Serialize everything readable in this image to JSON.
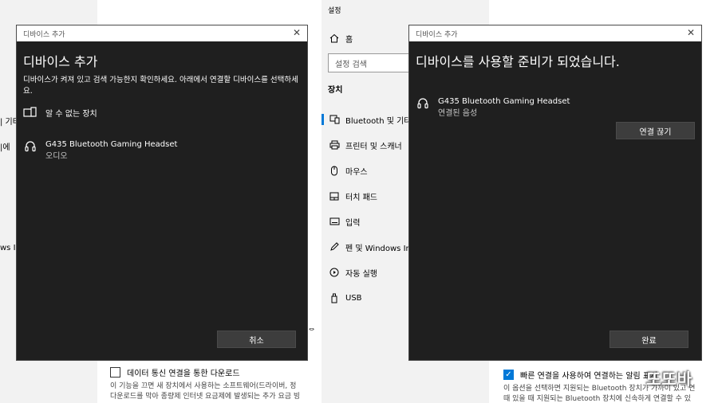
{
  "left_bg": {
    "fragment_1": "| 기타",
    "fragment_2": "|에",
    "fragment_3": "ws Ink",
    "fragment_4": "ᆼ",
    "checkbox_label": "데이터 통신 연결을 통한 다운로드",
    "desc_line1": "이 기능을 끄면 새 장치에서 사용하는 소프트웨어(드라이버, 정",
    "desc_line2": "다운로드를 막아 종량제 인터넷 요금제에 발생되는 추가 요금 빙"
  },
  "left_dialog": {
    "window_title": "디바이스 추가",
    "close_glyph": "✕",
    "heading": "디바이스 추가",
    "body_text": "디바이스가 켜져 있고 검색 가능한지 확인하세요. 아래에서 연결할 디바이스를 선택하세요.",
    "devices": [
      {
        "name": "알 수 없는 장치",
        "subtitle": "",
        "icon": "unknown-device-icon"
      },
      {
        "name": "G435 Bluetooth Gaming Headset",
        "subtitle": "오디오",
        "icon": "headset-icon"
      }
    ],
    "cancel_label": "취소"
  },
  "settings": {
    "title": "설정",
    "home_label": "홈",
    "search_placeholder": "설정 검색",
    "section_title": "장치",
    "nav_items": [
      {
        "label": "Bluetooth 및 기타",
        "icon": "bluetooth-devices-icon",
        "active": true
      },
      {
        "label": "프린터 및 스캐너",
        "icon": "printer-icon",
        "active": false
      },
      {
        "label": "마우스",
        "icon": "mouse-icon",
        "active": false
      },
      {
        "label": "터치 패드",
        "icon": "touchpad-icon",
        "active": false
      },
      {
        "label": "입력",
        "icon": "keyboard-icon",
        "active": false
      },
      {
        "label": "펜 및 Windows Ink",
        "icon": "pen-icon",
        "active": false
      },
      {
        "label": "자동 실행",
        "icon": "autoplay-icon",
        "active": false
      },
      {
        "label": "USB",
        "icon": "usb-icon",
        "active": false
      }
    ],
    "accent_color": "#0078d7"
  },
  "right_bg": {
    "checkbox_label": "빠른 연결을 사용하여 연결하는 알림 표시",
    "desc_line1": "이 옵션을 선택하면 지원되는 Bluetooth 장치가 가까이 있고 연",
    "desc_line2": "때 있을 때 지원되는 Bluetooth 장치에 신속하게 연결할 수 있"
  },
  "right_dialog": {
    "window_title": "디바이스 추가",
    "close_glyph": "✕",
    "heading": "디바이스를 사용할 준비가 되었습니다.",
    "device": {
      "name": "G435 Bluetooth Gaming Headset",
      "subtitle": "연결된 음성",
      "icon": "headset-icon"
    },
    "disconnect_label": "연결 끊기",
    "done_label": "완료"
  },
  "watermark": "또또바"
}
